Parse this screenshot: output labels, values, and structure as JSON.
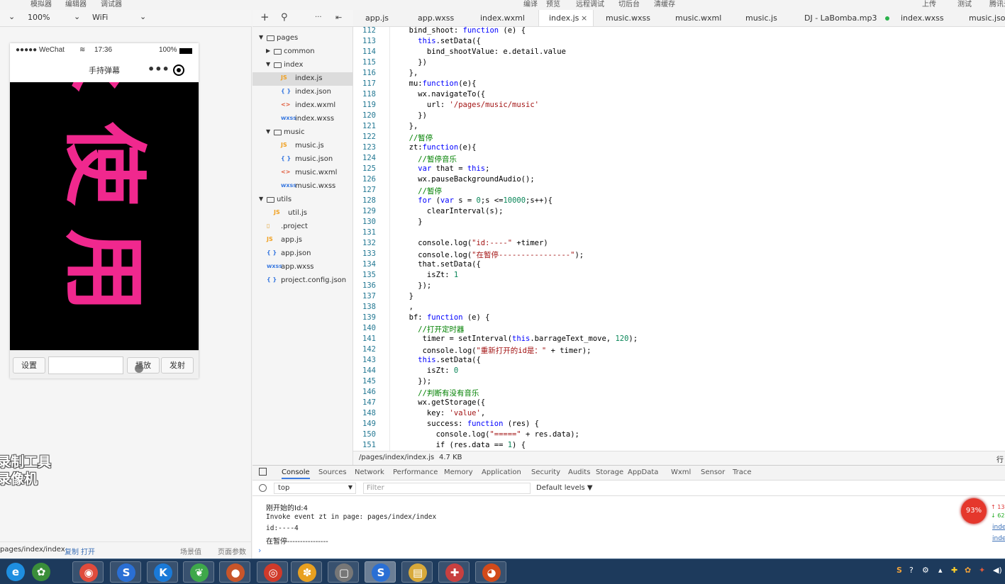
{
  "menu": [
    "模拟器",
    "编辑器",
    "调试器",
    "编译",
    "预览",
    "远程调试",
    "切后台",
    "清缓存",
    "上传",
    "测试",
    "腾讯云"
  ],
  "simulator": {
    "zoom": "100%",
    "network": "WiFi",
    "status": {
      "carrier": "●●●●● WeChat",
      "time": "17:36",
      "battery": "100%"
    },
    "nav_title": "手持弹幕",
    "danmu_text": [
      "使",
      "用"
    ],
    "buttons": {
      "settings": "设置",
      "play": "播放",
      "send": "发射"
    },
    "watermark": [
      "录制工具",
      "录像机"
    ],
    "footer": {
      "path": "pages/index/index",
      "copy": "复制",
      "open": "打开",
      "scene": "场景值",
      "params": "页面参数"
    }
  },
  "tree": [
    {
      "name": "pages",
      "type": "folder",
      "level": 0,
      "open": true
    },
    {
      "name": "common",
      "type": "folder",
      "level": 1,
      "open": false
    },
    {
      "name": "index",
      "type": "folder",
      "level": 1,
      "open": true
    },
    {
      "name": "index.js",
      "type": "js",
      "level": 2,
      "selected": true
    },
    {
      "name": "index.json",
      "type": "json",
      "level": 2
    },
    {
      "name": "index.wxml",
      "type": "wxml",
      "level": 2
    },
    {
      "name": "index.wxss",
      "type": "wxss",
      "level": 2
    },
    {
      "name": "music",
      "type": "folder",
      "level": 1,
      "open": true
    },
    {
      "name": "music.js",
      "type": "js",
      "level": 2
    },
    {
      "name": "music.json",
      "type": "json",
      "level": 2
    },
    {
      "name": "music.wxml",
      "type": "wxml",
      "level": 2
    },
    {
      "name": "music.wxss",
      "type": "wxss",
      "level": 2
    },
    {
      "name": "utils",
      "type": "folder",
      "level": 0,
      "open": true
    },
    {
      "name": "util.js",
      "type": "js",
      "level": 1
    },
    {
      "name": ".project",
      "type": "file",
      "level": 0
    },
    {
      "name": "app.js",
      "type": "js",
      "level": 0
    },
    {
      "name": "app.json",
      "type": "json",
      "level": 0
    },
    {
      "name": "app.wxss",
      "type": "wxss",
      "level": 0
    },
    {
      "name": "project.config.json",
      "type": "json",
      "level": 0
    }
  ],
  "tabs": [
    {
      "label": "app.js"
    },
    {
      "label": "app.wxss"
    },
    {
      "label": "index.wxml"
    },
    {
      "label": "index.js",
      "active": true
    },
    {
      "label": "music.wxss"
    },
    {
      "label": "music.wxml"
    },
    {
      "label": "music.js"
    },
    {
      "label": "DJ - LaBomba.mp3"
    },
    {
      "label": "index.wxss"
    },
    {
      "label": "music.json"
    }
  ],
  "code_start": 112,
  "code": [
    "  bind_shoot: function (e) {",
    "    this.setData({",
    "      bind_shootValue: e.detail.value",
    "    })",
    "  },",
    "  mu:function(e){",
    "    wx.navigateTo({",
    "      url: '/pages/music/music'",
    "    })",
    "  },",
    "  //暂停",
    "  zt:function(e){",
    "    //暂停音乐",
    "    var that = this;",
    "    wx.pauseBackgroundAudio();",
    "    //暂停",
    "    for (var s = 0;s <=10000;s++){",
    "      clearInterval(s);",
    "    }",
    "",
    "    console.log(\"id:----\" +timer)",
    "    console.log(\"在暂停----------------\");",
    "    that.setData({",
    "      isZt: 1",
    "    });",
    "  }",
    "  ,",
    "  bf: function (e) {",
    "    //打开定时器",
    "     timer = setInterval(this.barrageText_move, 120);",
    "     console.log(\"重新打开的id是：\" + timer);",
    "    this.setData({",
    "      isZt: 0",
    "    });",
    "    //判断有没有音乐",
    "    wx.getStorage({",
    "      key: 'value',",
    "      success: function (res) {",
    "        console.log(\"=====\" + res.data);",
    "        if (res.data == 1) {"
  ],
  "editor_status": {
    "path": "/pages/index/index.js",
    "size": "4.7 KB",
    "right": "行"
  },
  "devtools": {
    "tabs": [
      "Console",
      "Sources",
      "Network",
      "Performance",
      "Memory",
      "Application",
      "Security",
      "Audits",
      "Storage",
      "AppData",
      "Wxml",
      "Sensor",
      "Trace"
    ],
    "context": "top",
    "filter_placeholder": "Filter",
    "levels": "Default levels ▼",
    "lines": [
      "刚开始的Id:4",
      "Invoke event zt in page: pages/index/index",
      "id:----4",
      "在暂停----------------"
    ],
    "badge": "93%",
    "side_links": [
      "inde",
      "inde"
    ],
    "net": [
      "↑ 13",
      "↓ 62"
    ]
  },
  "taskbar": [
    {
      "name": "ie",
      "glyph": "e",
      "color": "#1e8ee0"
    },
    {
      "name": "windows-live",
      "glyph": "✿",
      "color": "#3a8e3a"
    },
    {
      "name": "chrome",
      "glyph": "◉",
      "color": "#e04b3c"
    },
    {
      "name": "sogou",
      "glyph": "S",
      "color": "#2a6fd4"
    },
    {
      "name": "kugou",
      "glyph": "K",
      "color": "#1a7ad8"
    },
    {
      "name": "leaf",
      "glyph": "❦",
      "color": "#3ea84a"
    },
    {
      "name": "app",
      "glyph": "●",
      "color": "#c8552a"
    },
    {
      "name": "snail",
      "glyph": "◎",
      "color": "#d03a2a"
    },
    {
      "name": "paw",
      "glyph": "✽",
      "color": "#e8a020"
    },
    {
      "name": "window",
      "glyph": "▢",
      "color": "#777777"
    },
    {
      "name": "sogou-active",
      "glyph": "S",
      "color": "#2a6fd4"
    },
    {
      "name": "folder",
      "glyph": "▤",
      "color": "#d8a93a"
    },
    {
      "name": "pin",
      "glyph": "✚",
      "color": "#c84040"
    },
    {
      "name": "fox",
      "glyph": "◕",
      "color": "#d24a1a"
    }
  ],
  "colors": {
    "danmu": "#f0288e",
    "taskbar": "#1d3a5c",
    "badge": "#e5372c"
  }
}
